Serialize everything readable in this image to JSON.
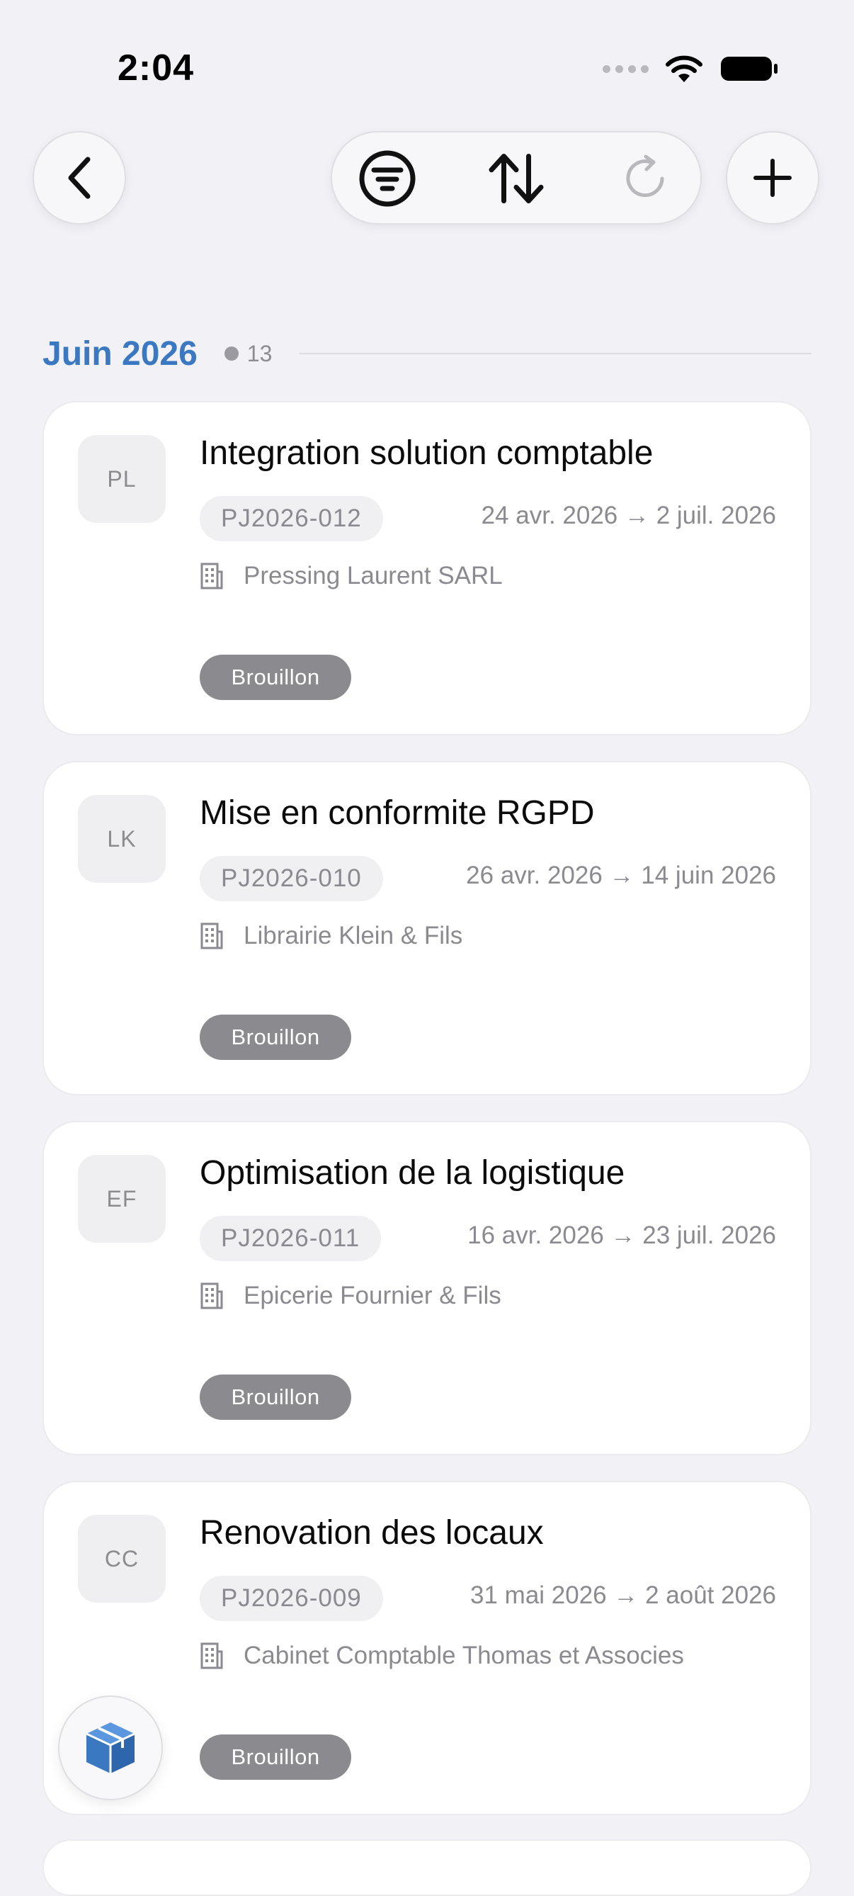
{
  "status_bar": {
    "time": "2:04"
  },
  "toolbar": {
    "back_icon": "chevron-left-icon",
    "filter_icon": "filter-icon",
    "sort_icon": "sort-arrows-icon",
    "refresh_icon": "refresh-icon",
    "add_icon": "plus-icon"
  },
  "section": {
    "title": "Juin 2026",
    "count": "13"
  },
  "projects": [
    {
      "initials": "PL",
      "title": "Integration solution comptable",
      "reference": "PJ2026-012",
      "dates": "24 avr. 2026 → 2 juil. 2026",
      "client": "Pressing Laurent SARL",
      "status": "Brouillon"
    },
    {
      "initials": "LK",
      "title": "Mise en conformite RGPD",
      "reference": "PJ2026-010",
      "dates": "26 avr. 2026 → 14 juin 2026",
      "client": "Librairie Klein & Fils",
      "status": "Brouillon"
    },
    {
      "initials": "EF",
      "title": "Optimisation de la logistique",
      "reference": "PJ2026-011",
      "dates": "16 avr. 2026 → 23 juil. 2026",
      "client": "Epicerie Fournier & Fils",
      "status": "Brouillon"
    },
    {
      "initials": "CC",
      "title": "Renovation des locaux",
      "reference": "PJ2026-009",
      "dates": "31 mai 2026 → 2 août 2026",
      "client": "Cabinet Comptable Thomas et Associes",
      "status": "Brouillon"
    }
  ],
  "colors": {
    "accent": "#3a78c2",
    "status_draft": "#8b8b8f",
    "background": "#f1f1f6"
  }
}
